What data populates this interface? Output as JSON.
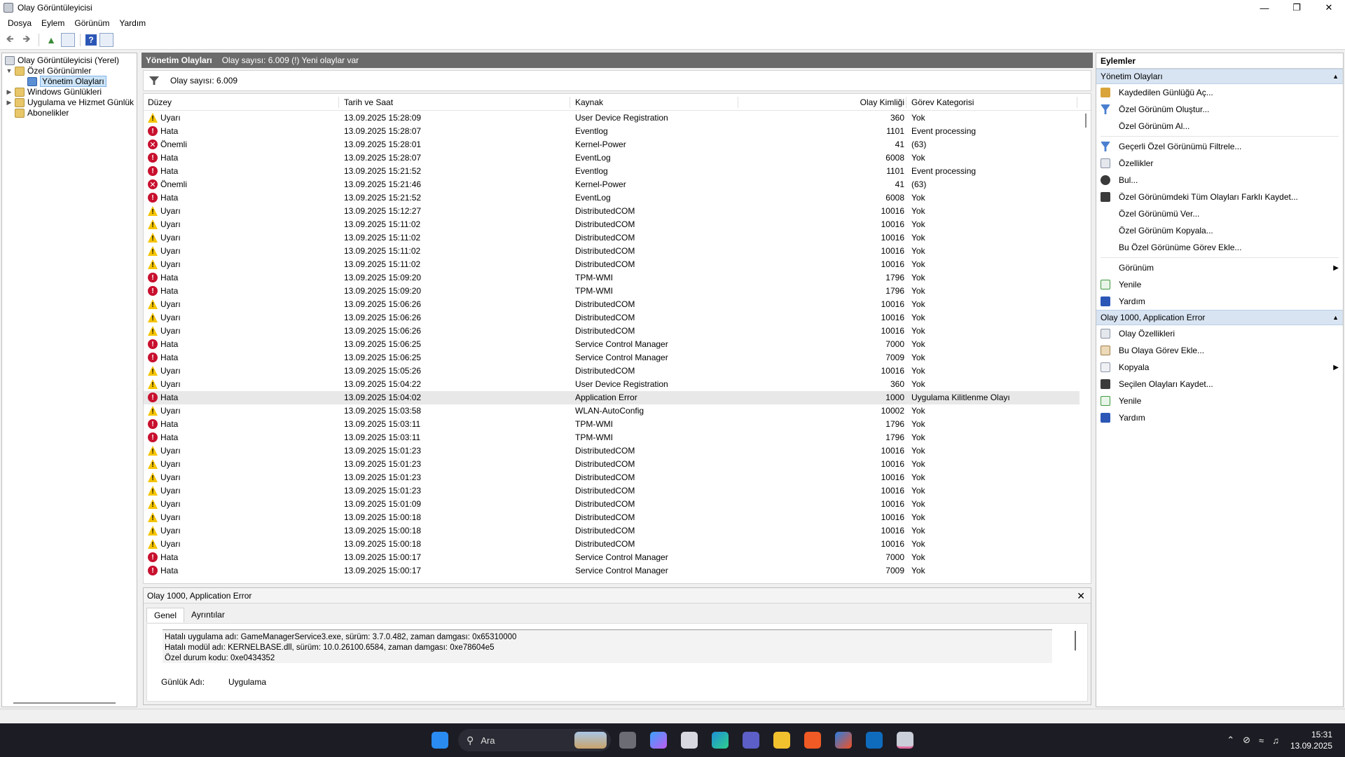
{
  "window": {
    "title": "Olay Görüntüleyicisi"
  },
  "menu": [
    "Dosya",
    "Eylem",
    "Görünüm",
    "Yardım"
  ],
  "tree": {
    "root": "Olay Görüntüleyicisi (Yerel)",
    "custom_views": "Özel Görünümler",
    "admin_events": "Yönetim Olayları",
    "windows_logs": "Windows Günlükleri",
    "app_service_logs": "Uygulama ve Hizmet Günlük",
    "subscriptions": "Abonelikler"
  },
  "middle": {
    "header_title": "Yönetim Olayları",
    "header_info": "Olay sayısı: 6.009 (!) Yeni olaylar var",
    "filter_text": "Olay sayısı: 6.009",
    "columns": {
      "level": "Düzey",
      "date": "Tarih ve Saat",
      "source": "Kaynak",
      "id": "Olay Kimliği",
      "category": "Görev Kategorisi"
    },
    "rows": [
      {
        "level": "Uyarı",
        "type": "warn",
        "date": "13.09.2025 15:28:09",
        "source": "User Device Registration",
        "id": "360",
        "category": "Yok"
      },
      {
        "level": "Hata",
        "type": "err",
        "date": "13.09.2025 15:28:07",
        "source": "Eventlog",
        "id": "1101",
        "category": "Event processing"
      },
      {
        "level": "Önemli",
        "type": "crit",
        "date": "13.09.2025 15:28:01",
        "source": "Kernel-Power",
        "id": "41",
        "category": "(63)"
      },
      {
        "level": "Hata",
        "type": "err",
        "date": "13.09.2025 15:28:07",
        "source": "EventLog",
        "id": "6008",
        "category": "Yok"
      },
      {
        "level": "Hata",
        "type": "err",
        "date": "13.09.2025 15:21:52",
        "source": "Eventlog",
        "id": "1101",
        "category": "Event processing"
      },
      {
        "level": "Önemli",
        "type": "crit",
        "date": "13.09.2025 15:21:46",
        "source": "Kernel-Power",
        "id": "41",
        "category": "(63)"
      },
      {
        "level": "Hata",
        "type": "err",
        "date": "13.09.2025 15:21:52",
        "source": "EventLog",
        "id": "6008",
        "category": "Yok"
      },
      {
        "level": "Uyarı",
        "type": "warn",
        "date": "13.09.2025 15:12:27",
        "source": "DistributedCOM",
        "id": "10016",
        "category": "Yok"
      },
      {
        "level": "Uyarı",
        "type": "warn",
        "date": "13.09.2025 15:11:02",
        "source": "DistributedCOM",
        "id": "10016",
        "category": "Yok"
      },
      {
        "level": "Uyarı",
        "type": "warn",
        "date": "13.09.2025 15:11:02",
        "source": "DistributedCOM",
        "id": "10016",
        "category": "Yok"
      },
      {
        "level": "Uyarı",
        "type": "warn",
        "date": "13.09.2025 15:11:02",
        "source": "DistributedCOM",
        "id": "10016",
        "category": "Yok"
      },
      {
        "level": "Uyarı",
        "type": "warn",
        "date": "13.09.2025 15:11:02",
        "source": "DistributedCOM",
        "id": "10016",
        "category": "Yok"
      },
      {
        "level": "Hata",
        "type": "err",
        "date": "13.09.2025 15:09:20",
        "source": "TPM-WMI",
        "id": "1796",
        "category": "Yok"
      },
      {
        "level": "Hata",
        "type": "err",
        "date": "13.09.2025 15:09:20",
        "source": "TPM-WMI",
        "id": "1796",
        "category": "Yok"
      },
      {
        "level": "Uyarı",
        "type": "warn",
        "date": "13.09.2025 15:06:26",
        "source": "DistributedCOM",
        "id": "10016",
        "category": "Yok"
      },
      {
        "level": "Uyarı",
        "type": "warn",
        "date": "13.09.2025 15:06:26",
        "source": "DistributedCOM",
        "id": "10016",
        "category": "Yok"
      },
      {
        "level": "Uyarı",
        "type": "warn",
        "date": "13.09.2025 15:06:26",
        "source": "DistributedCOM",
        "id": "10016",
        "category": "Yok"
      },
      {
        "level": "Hata",
        "type": "err",
        "date": "13.09.2025 15:06:25",
        "source": "Service Control Manager",
        "id": "7000",
        "category": "Yok"
      },
      {
        "level": "Hata",
        "type": "err",
        "date": "13.09.2025 15:06:25",
        "source": "Service Control Manager",
        "id": "7009",
        "category": "Yok"
      },
      {
        "level": "Uyarı",
        "type": "warn",
        "date": "13.09.2025 15:05:26",
        "source": "DistributedCOM",
        "id": "10016",
        "category": "Yok"
      },
      {
        "level": "Uyarı",
        "type": "warn",
        "date": "13.09.2025 15:04:22",
        "source": "User Device Registration",
        "id": "360",
        "category": "Yok"
      },
      {
        "level": "Hata",
        "type": "err",
        "date": "13.09.2025 15:04:02",
        "source": "Application Error",
        "id": "1000",
        "category": "Uygulama Kilitlenme Olayı",
        "selected": true
      },
      {
        "level": "Uyarı",
        "type": "warn",
        "date": "13.09.2025 15:03:58",
        "source": "WLAN-AutoConfig",
        "id": "10002",
        "category": "Yok"
      },
      {
        "level": "Hata",
        "type": "err",
        "date": "13.09.2025 15:03:11",
        "source": "TPM-WMI",
        "id": "1796",
        "category": "Yok"
      },
      {
        "level": "Hata",
        "type": "err",
        "date": "13.09.2025 15:03:11",
        "source": "TPM-WMI",
        "id": "1796",
        "category": "Yok"
      },
      {
        "level": "Uyarı",
        "type": "warn",
        "date": "13.09.2025 15:01:23",
        "source": "DistributedCOM",
        "id": "10016",
        "category": "Yok"
      },
      {
        "level": "Uyarı",
        "type": "warn",
        "date": "13.09.2025 15:01:23",
        "source": "DistributedCOM",
        "id": "10016",
        "category": "Yok"
      },
      {
        "level": "Uyarı",
        "type": "warn",
        "date": "13.09.2025 15:01:23",
        "source": "DistributedCOM",
        "id": "10016",
        "category": "Yok"
      },
      {
        "level": "Uyarı",
        "type": "warn",
        "date": "13.09.2025 15:01:23",
        "source": "DistributedCOM",
        "id": "10016",
        "category": "Yok"
      },
      {
        "level": "Uyarı",
        "type": "warn",
        "date": "13.09.2025 15:01:09",
        "source": "DistributedCOM",
        "id": "10016",
        "category": "Yok"
      },
      {
        "level": "Uyarı",
        "type": "warn",
        "date": "13.09.2025 15:00:18",
        "source": "DistributedCOM",
        "id": "10016",
        "category": "Yok"
      },
      {
        "level": "Uyarı",
        "type": "warn",
        "date": "13.09.2025 15:00:18",
        "source": "DistributedCOM",
        "id": "10016",
        "category": "Yok"
      },
      {
        "level": "Uyarı",
        "type": "warn",
        "date": "13.09.2025 15:00:18",
        "source": "DistributedCOM",
        "id": "10016",
        "category": "Yok"
      },
      {
        "level": "Hata",
        "type": "err",
        "date": "13.09.2025 15:00:17",
        "source": "Service Control Manager",
        "id": "7000",
        "category": "Yok"
      },
      {
        "level": "Hata",
        "type": "err",
        "date": "13.09.2025 15:00:17",
        "source": "Service Control Manager",
        "id": "7009",
        "category": "Yok"
      }
    ]
  },
  "detail": {
    "title": "Olay 1000, Application Error",
    "tabs": [
      "Genel",
      "Ayrıntılar"
    ],
    "message": [
      "Hatalı uygulama adı: GameManagerService3.exe, sürüm: 3.7.0.482, zaman damgası: 0x65310000",
      "Hatalı modül adı: KERNELBASE.dll, sürüm: 10.0.26100.6584, zaman damgası: 0xe78604e5",
      "Özel durum kodu: 0xe0434352"
    ],
    "log_label": "Günlük Adı:",
    "log_value": "Uygulama"
  },
  "actions": {
    "title": "Eylemler",
    "section1": "Yönetim Olayları",
    "items1": [
      {
        "label": "Kaydedilen Günlüğü Aç...",
        "icon": "open"
      },
      {
        "label": "Özel Görünüm Oluştur...",
        "icon": "filter"
      },
      {
        "label": "Özel Görünüm Al...",
        "icon": "blank"
      },
      {
        "label": "Geçerli Özel Görünümü Filtrele...",
        "icon": "filter"
      },
      {
        "label": "Özellikler",
        "icon": "prop"
      },
      {
        "label": "Bul...",
        "icon": "find"
      },
      {
        "label": "Özel Görünümdeki Tüm Olayları Farklı Kaydet...",
        "icon": "save"
      },
      {
        "label": "Özel Görünümü Ver...",
        "icon": "blank"
      },
      {
        "label": "Özel Görünüm Kopyala...",
        "icon": "blank"
      },
      {
        "label": "Bu Özel Görünüme Görev Ekle...",
        "icon": "blank"
      },
      {
        "label": "Görünüm",
        "icon": "blank",
        "submenu": true
      },
      {
        "label": "Yenile",
        "icon": "refresh"
      },
      {
        "label": "Yardım",
        "icon": "help",
        "submenu_help": true
      }
    ],
    "section2": "Olay 1000, Application Error",
    "items2": [
      {
        "label": "Olay Özellikleri",
        "icon": "prop"
      },
      {
        "label": "Bu Olaya Görev Ekle...",
        "icon": "task"
      },
      {
        "label": "Kopyala",
        "icon": "copy",
        "submenu": true
      },
      {
        "label": "Seçilen Olayları Kaydet...",
        "icon": "save"
      },
      {
        "label": "Yenile",
        "icon": "refresh"
      },
      {
        "label": "Yardım",
        "icon": "help"
      }
    ]
  },
  "taskbar": {
    "search_placeholder": "Ara",
    "time": "15:31",
    "date": "13.09.2025"
  }
}
